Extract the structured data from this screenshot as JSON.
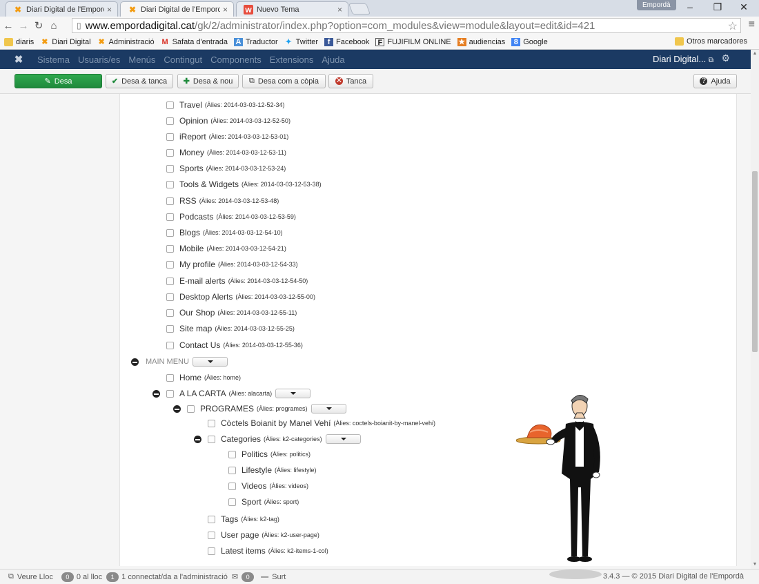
{
  "browser": {
    "tabs": [
      {
        "label": "Diari Digital de l'Empordà",
        "active": false
      },
      {
        "label": "Diari Digital de l'Empordà",
        "active": true
      },
      {
        "label": "Nuevo Tema",
        "active": false
      }
    ],
    "profile": "Empordà",
    "url_host": "www.empordadigital.cat",
    "url_path": "/gk/2/administrator/index.php?option=com_modules&view=module&layout=edit&id=421",
    "bookmarks": [
      {
        "label": "diaris",
        "icon": "folder-icon"
      },
      {
        "label": "Diari Digital",
        "icon": "joomla-icon"
      },
      {
        "label": "Administració",
        "icon": "joomla-icon"
      },
      {
        "label": "Safata d'entrada",
        "icon": "gmail-icon"
      },
      {
        "label": "Traductor",
        "icon": "translate-icon"
      },
      {
        "label": "Twitter",
        "icon": "twitter-icon"
      },
      {
        "label": "Facebook",
        "icon": "facebook-icon"
      },
      {
        "label": "FUJIFILM ONLINE",
        "icon": "fujifilm-icon"
      },
      {
        "label": "audiencias",
        "icon": "star-icon"
      },
      {
        "label": "Google",
        "icon": "google-icon"
      }
    ],
    "other_bookmarks": "Otros marcadores"
  },
  "navbar": {
    "items": [
      "Sistema",
      "Usuaris/es",
      "Menús",
      "Contingut",
      "Components",
      "Extensions",
      "Ajuda"
    ],
    "site_label": "Diari Digital..."
  },
  "toolbar": {
    "save": "Desa",
    "save_close": "Desa & tanca",
    "save_new": "Desa & nou",
    "save_copy": "Desa com a còpia",
    "close": "Tanca",
    "help": "Ajuda"
  },
  "menu_items_top": [
    {
      "label": "Travel",
      "alias": "(Àlies: 2014-03-03-12-52-34)"
    },
    {
      "label": "Opinion",
      "alias": "(Àlies: 2014-03-03-12-52-50)"
    },
    {
      "label": "iReport",
      "alias": "(Àlies: 2014-03-03-12-53-01)"
    },
    {
      "label": "Money",
      "alias": "(Àlies: 2014-03-03-12-53-11)"
    },
    {
      "label": "Sports",
      "alias": "(Àlies: 2014-03-03-12-53-24)"
    },
    {
      "label": "Tools & Widgets",
      "alias": "(Àlies: 2014-03-03-12-53-38)"
    },
    {
      "label": "RSS",
      "alias": "(Àlies: 2014-03-03-12-53-48)"
    },
    {
      "label": "Podcasts",
      "alias": "(Àlies: 2014-03-03-12-53-59)"
    },
    {
      "label": "Blogs",
      "alias": "(Àlies: 2014-03-03-12-54-10)"
    },
    {
      "label": "Mobile",
      "alias": "(Àlies: 2014-03-03-12-54-21)"
    },
    {
      "label": "My profile",
      "alias": "(Àlies: 2014-03-03-12-54-33)"
    },
    {
      "label": "E-mail alerts",
      "alias": "(Àlies: 2014-03-03-12-54-50)"
    },
    {
      "label": "Desktop Alerts",
      "alias": "(Àlies: 2014-03-03-12-55-00)"
    },
    {
      "label": "Our Shop",
      "alias": "(Àlies: 2014-03-03-12-55-11)"
    },
    {
      "label": "Site map",
      "alias": "(Àlies: 2014-03-03-12-55-25)"
    },
    {
      "label": "Contact Us",
      "alias": "(Àlies: 2014-03-03-12-55-36)"
    }
  ],
  "main_menu": {
    "heading": "MAIN MENU",
    "home": {
      "label": "Home",
      "alias": "(Àlies: home)"
    },
    "a_la_carta": {
      "label": "A LA CARTA",
      "alias": "(Àlies: alacarta)"
    },
    "programes": {
      "label": "PROGRAMES",
      "alias": "(Àlies: programes)"
    },
    "coctels": {
      "label": "Còctels Boianit by Manel Vehí",
      "alias": "(Àlies: coctels-boianit-by-manel-vehi)"
    },
    "categories": {
      "label": "Categories",
      "alias": "(Àlies: k2-categories)"
    },
    "category_children": [
      {
        "label": "Politics",
        "alias": "(Àlies: politics)"
      },
      {
        "label": "Lifestyle",
        "alias": "(Àlies: lifestyle)"
      },
      {
        "label": "Videos",
        "alias": "(Àlies: videos)"
      },
      {
        "label": "Sport",
        "alias": "(Àlies: sport)"
      }
    ],
    "after_categories": [
      {
        "label": "Tags",
        "alias": "(Àlies: k2-tag)"
      },
      {
        "label": "User page",
        "alias": "(Àlies: k2-user-page)"
      },
      {
        "label": "Latest items",
        "alias": "(Àlies: k2-items-1-col)"
      }
    ]
  },
  "statusbar": {
    "view_site": "Veure Lloc",
    "visitors_count": "0",
    "visitors_label": "0 al lloc",
    "admins_count": "1",
    "admins_label": "1 connectat/da a l'administració",
    "messages_count": "0",
    "logout": "Surt",
    "version_fragment": "3.4.3",
    "copyright": "— © 2015 Diari Digital de l'Empordà"
  }
}
